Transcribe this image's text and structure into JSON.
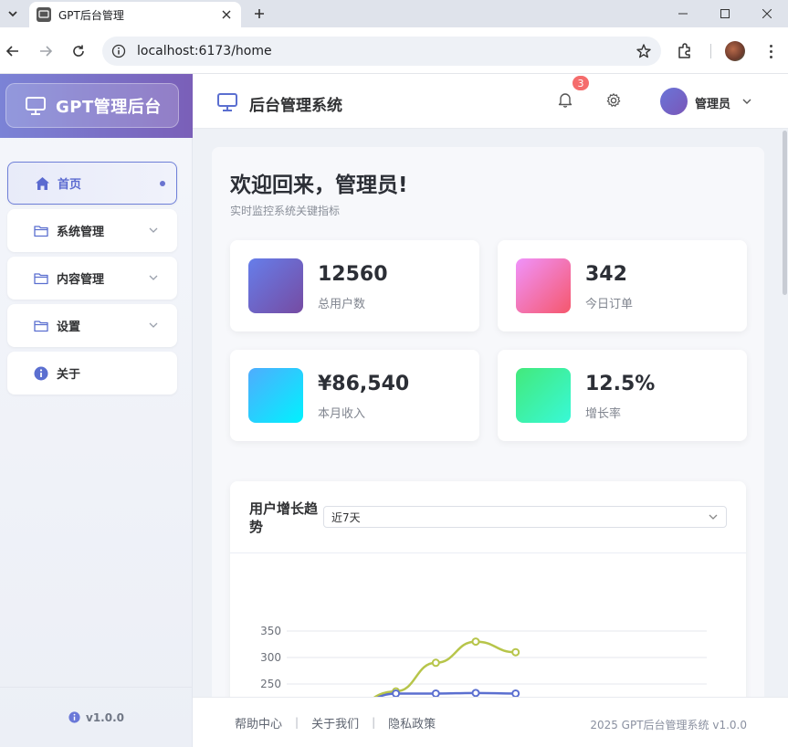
{
  "browser": {
    "tab_title": "GPT后台管理",
    "url": "localhost:6173/home"
  },
  "sidebar": {
    "brand": "GPT管理后台",
    "items": [
      {
        "label": "首页",
        "icon": "home-icon",
        "active": true
      },
      {
        "label": "系统管理",
        "icon": "folder-icon",
        "expandable": true
      },
      {
        "label": "内容管理",
        "icon": "folder-icon",
        "expandable": true
      },
      {
        "label": "设置",
        "icon": "folder-icon",
        "expandable": true
      },
      {
        "label": "关于",
        "icon": "info-icon"
      }
    ],
    "version": "v1.0.0"
  },
  "header": {
    "title": "后台管理系统",
    "notification_count": "3",
    "user_name": "管理员"
  },
  "main": {
    "welcome_title": "欢迎回来，管理员!",
    "welcome_subtitle": "实时监控系统关键指标",
    "stats": [
      {
        "value": "12560",
        "label": "总用户数",
        "color_from": "#667eea",
        "color_to": "#764ba2"
      },
      {
        "value": "342",
        "label": "今日订单",
        "color_from": "#f093fb",
        "color_to": "#f5576c"
      },
      {
        "value": "¥86,540",
        "label": "本月收入",
        "color_from": "#4facfe",
        "color_to": "#00f2fe"
      },
      {
        "value": "12.5%",
        "label": "增长率",
        "color_from": "#43e97b",
        "color_to": "#38f9d7"
      }
    ],
    "chart_section": {
      "title": "用户增长趋势",
      "range_select": "近7天"
    }
  },
  "chart_data": {
    "type": "line",
    "y_ticks": [
      250,
      300,
      350
    ],
    "visible_ylim": [
      230,
      360
    ],
    "series": [
      {
        "color": "#b7c54a",
        "points": [
          [
            0.52,
            236
          ],
          [
            0.71,
            290
          ],
          [
            0.9,
            330
          ],
          [
            1.09,
            310
          ]
        ]
      },
      {
        "color": "#5b6fd0",
        "points": [
          [
            0.52,
            232
          ],
          [
            0.71,
            232
          ],
          [
            0.9,
            233
          ],
          [
            1.09,
            232
          ]
        ]
      }
    ]
  },
  "footer": {
    "links": [
      "帮助中心",
      "关于我们",
      "隐私政策"
    ],
    "copyright": "2025 GPT后台管理系统 v1.0.0"
  }
}
